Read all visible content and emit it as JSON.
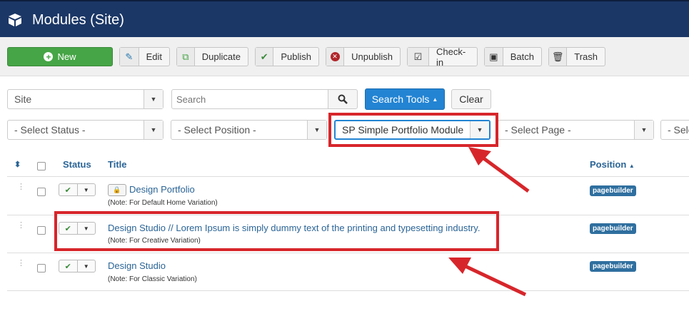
{
  "header": {
    "title": "Modules (Site)",
    "icon": "cube-icon"
  },
  "toolbar": {
    "new": "New",
    "edit": "Edit",
    "duplicate": "Duplicate",
    "publish": "Publish",
    "unpublish": "Unpublish",
    "checkin": "Check-in",
    "batch": "Batch",
    "trash": "Trash"
  },
  "filters": {
    "client": "Site",
    "search_placeholder": "Search",
    "search_tools": "Search Tools",
    "clear": "Clear",
    "status": "- Select Status -",
    "position": "- Select Position -",
    "module_type": "SP Simple Portfolio Module",
    "page": "- Select Page -",
    "more": "- Sele"
  },
  "table": {
    "headers": {
      "status": "Status",
      "title": "Title",
      "position": "Position"
    },
    "rows": [
      {
        "title": "Design Portfolio",
        "note": "(Note: For Default Home Variation)",
        "position": "pagebuilder",
        "locked": true
      },
      {
        "title": "Design Studio // Lorem Ipsum is simply dummy text of the printing and typesetting industry.",
        "note": "(Note: For Creative Variation)",
        "position": "pagebuilder"
      },
      {
        "title": "Design Studio",
        "note": "(Note: For Classic Variation)",
        "position": "pagebuilder"
      }
    ]
  },
  "colors": {
    "header": "#1b3766",
    "green": "#46a546",
    "blue": "#2384d3",
    "annotation": "#d7262b"
  }
}
